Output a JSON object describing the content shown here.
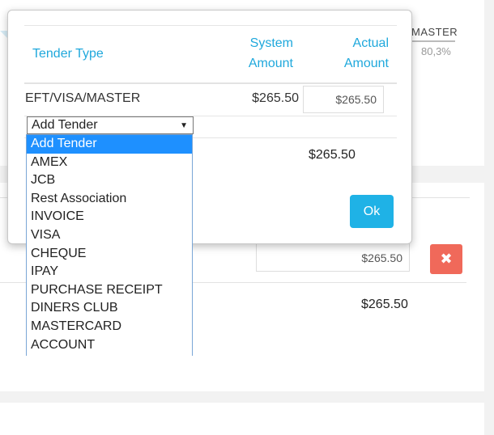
{
  "background": {
    "tender_label": "MASTER",
    "percent": "80,3%",
    "actual_amount": "$265.50",
    "total": "$265.50",
    "delete_icon": "close-icon"
  },
  "modal": {
    "headers": {
      "tender_type": "Tender Type",
      "system_amount_line1": "System",
      "system_amount_line2": "Amount",
      "actual_amount_line1": "Actual",
      "actual_amount_line2": "Amount"
    },
    "row": {
      "tender_type": "EFT/VISA/MASTER",
      "system_amount": "$265.50",
      "actual_amount": "$265.50"
    },
    "select": {
      "value": "Add Tender",
      "arrow_icon": "caret-down-icon"
    },
    "total": "$265.50",
    "ok_label": "Ok"
  },
  "dropdown": {
    "options": [
      {
        "label": "Add Tender",
        "selected": true
      },
      {
        "label": "AMEX",
        "selected": false
      },
      {
        "label": "JCB",
        "selected": false
      },
      {
        "label": "Rest Association",
        "selected": false
      },
      {
        "label": "INVOICE",
        "selected": false
      },
      {
        "label": "VISA",
        "selected": false
      },
      {
        "label": "CHEQUE",
        "selected": false
      },
      {
        "label": "IPAY",
        "selected": false
      },
      {
        "label": "PURCHASE RECEIPT",
        "selected": false
      },
      {
        "label": "DINERS CLUB",
        "selected": false
      },
      {
        "label": "MASTERCARD",
        "selected": false
      },
      {
        "label": "ACCOUNT",
        "selected": false
      }
    ]
  },
  "colors": {
    "accent": "#1fa8dc",
    "ok_button": "#1fb2e6",
    "delete_button": "#f0695a",
    "selected_option": "#1e90ff"
  }
}
